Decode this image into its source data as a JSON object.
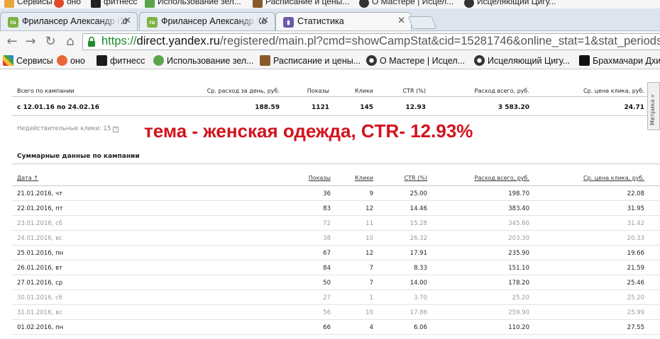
{
  "browser": {
    "top_bookmarks": [
      {
        "label": "Сервисы",
        "icon": "apps-icon"
      },
      {
        "label": "оно",
        "icon": "heart-icon"
      },
      {
        "label": "фитнесс",
        "icon": "fitness-icon"
      },
      {
        "label": "Использование зел...",
        "icon": "leaf-icon"
      },
      {
        "label": "Расписание и цены...",
        "icon": "schedule-icon"
      },
      {
        "label": "О Мастере | Исцел...",
        "icon": "yinyang-icon"
      },
      {
        "label": "Исцеляющий Цигу...",
        "icon": "yinyang-icon"
      }
    ],
    "tabs": [
      {
        "title": "Фрилансер Александр Ко",
        "favicon": "ru",
        "active": false
      },
      {
        "title": "Фрилансер Александр Ко",
        "favicon": "ru",
        "active": false
      },
      {
        "title": "Статистика",
        "favicon": "stats",
        "active": true
      }
    ],
    "url": {
      "scheme": "https://",
      "host": "direct.yandex.ru",
      "path": "/registered/main.pl?cmd=showCampStat&cid=15281746&online_stat=1&stat_periods=2"
    },
    "bookmarks": [
      {
        "label": "Сервисы",
        "icon": "apps-icon"
      },
      {
        "label": "оно",
        "icon": "heart-icon"
      },
      {
        "label": "фитнесс",
        "icon": "fitness-icon"
      },
      {
        "label": "Использование зел...",
        "icon": "leaf-icon"
      },
      {
        "label": "Расписание и цены...",
        "icon": "schedule-icon"
      },
      {
        "label": "О Мастере | Исцел...",
        "icon": "yinyang-icon"
      },
      {
        "label": "Исцеляющий Цигу...",
        "icon": "yinyang-icon"
      },
      {
        "label": "Брахмачари Дхир",
        "icon": "brahmachari-icon"
      }
    ]
  },
  "summary": {
    "headers": {
      "total": "Всего по кампании",
      "avg_day": "Ср. расход за день, руб.",
      "shows": "Показы",
      "clicks": "Клики",
      "ctr": "CTR (%)",
      "spend": "Расход всего, руб.",
      "avg_cpc": "Ср. цена клика, руб."
    },
    "values": {
      "period": "с 12.01.16 по 24.02.16",
      "avg_day": "188.59",
      "shows": "1121",
      "clicks": "145",
      "ctr": "12.93",
      "spend": "3 583.20",
      "avg_cpc": "24.71"
    },
    "invalid_clicks": "Недействительные клики: 15",
    "help": "?"
  },
  "overlay_text": "тема - женская одежда, CTR- 12.93%",
  "metrika": "Метрика »",
  "section_title": "Суммарные данные по кампании",
  "table": {
    "headers": {
      "date": "Дата ↑",
      "shows": "Показы",
      "clicks": "Клики",
      "ctr": "CTR (%)",
      "spend": "Расход всего, руб.",
      "cpc": "Ср. цена клика, руб."
    },
    "rows": [
      {
        "date": "21.01.2016, чт",
        "shows": "36",
        "clicks": "9",
        "ctr": "25.00",
        "spend": "198.70",
        "cpc": "22.08",
        "weekend": false
      },
      {
        "date": "22.01.2016, пт",
        "shows": "83",
        "clicks": "12",
        "ctr": "14.46",
        "spend": "383.40",
        "cpc": "31.95",
        "weekend": false
      },
      {
        "date": "23.01.2016, сб",
        "shows": "72",
        "clicks": "11",
        "ctr": "15.28",
        "spend": "345.60",
        "cpc": "31.42",
        "weekend": true
      },
      {
        "date": "24.01.2016, вс",
        "shows": "38",
        "clicks": "10",
        "ctr": "26.32",
        "spend": "203.30",
        "cpc": "20.33",
        "weekend": true
      },
      {
        "date": "25.01.2016, пн",
        "shows": "67",
        "clicks": "12",
        "ctr": "17.91",
        "spend": "235.90",
        "cpc": "19.66",
        "weekend": false
      },
      {
        "date": "26.01.2016, вт",
        "shows": "84",
        "clicks": "7",
        "ctr": "8.33",
        "spend": "151.10",
        "cpc": "21.59",
        "weekend": false
      },
      {
        "date": "27.01.2016, ср",
        "shows": "50",
        "clicks": "7",
        "ctr": "14.00",
        "spend": "178.20",
        "cpc": "25.46",
        "weekend": false
      },
      {
        "date": "30.01.2016, сб",
        "shows": "27",
        "clicks": "1",
        "ctr": "3.70",
        "spend": "25.20",
        "cpc": "25.20",
        "weekend": true
      },
      {
        "date": "31.01.2016, вс",
        "shows": "56",
        "clicks": "10",
        "ctr": "17.86",
        "spend": "259.90",
        "cpc": "25.99",
        "weekend": true
      },
      {
        "date": "01.02.2016, пн",
        "shows": "66",
        "clicks": "4",
        "ctr": "6.06",
        "spend": "110.20",
        "cpc": "27.55",
        "weekend": false
      }
    ]
  },
  "colors": {
    "overlay": "#d2131d",
    "https": "#1d8a2e",
    "weekend_text": "#9a9a9a"
  }
}
